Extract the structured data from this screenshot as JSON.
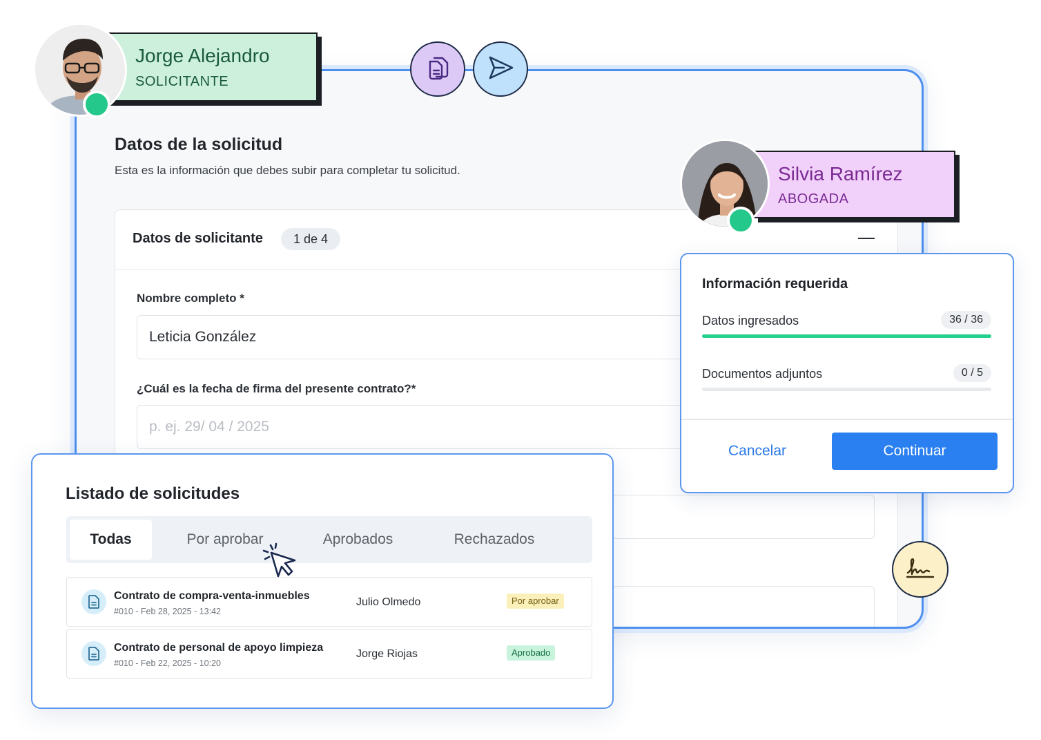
{
  "form": {
    "title": "Datos de la solicitud",
    "subtitle": "Esta es la información que debes subir para completar tu solicitud.",
    "section": {
      "title": "Datos de solicitante",
      "step": "1 de 4"
    },
    "fields": {
      "full_name": {
        "label": "Nombre completo *",
        "value": "Leticia González"
      },
      "sign_date": {
        "label": "¿Cuál es la fecha de firma del presente contrato?*",
        "placeholder": "p. ej. 29/ 04 / 2025"
      }
    }
  },
  "users": {
    "applicant": {
      "name": "Jorge Alejandro",
      "role": "SOLICITANTE",
      "status": "online"
    },
    "lawyer": {
      "name": "Silvia Ramírez",
      "role": "ABOGADA",
      "status": "online"
    }
  },
  "info_dialog": {
    "title": "Información requerida",
    "items": [
      {
        "label": "Datos ingresados",
        "count": "36 / 36",
        "progress": 1.0
      },
      {
        "label": "Documentos adjuntos",
        "count": "0 / 5",
        "progress": 0.0
      }
    ],
    "cancel_label": "Cancelar",
    "continue_label": "Continuar"
  },
  "requests_list": {
    "title": "Listado de solicitudes",
    "tabs": [
      "Todas",
      "Por aprobar",
      "Aprobados",
      "Rechazados"
    ],
    "active_tab": "Todas",
    "rows": [
      {
        "title": "Contrato de compra-venta-inmuebles",
        "meta": "#010 - Feb 28, 2025 - 13:42",
        "person": "Julio Olmedo",
        "status": "Por aprobar"
      },
      {
        "title": "Contrato de personal de apoyo limpieza",
        "meta": "#010 - Feb 22, 2025 - 10:20",
        "person": "Jorge Riojas",
        "status": "Aprobado"
      }
    ]
  },
  "icons": {
    "documents": "documents-icon",
    "send": "send-icon",
    "signature": "signature-icon",
    "collapse": "minus-icon",
    "document": "document-icon",
    "cursor": "pointer-cursor-icon"
  },
  "colors": {
    "accent": "#2a80f0",
    "success": "#23d08d",
    "applicant_tag": "#cdf0dd",
    "lawyer_tag": "#f1d0fa",
    "pending_badge": "#fbf0b9",
    "approved_badge": "#c8f3dc"
  }
}
